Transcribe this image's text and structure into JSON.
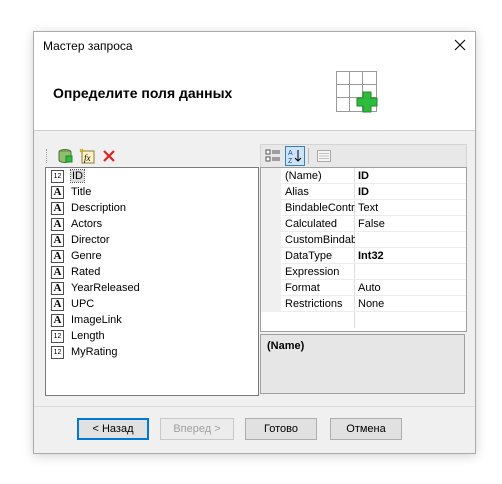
{
  "window": {
    "title": "Мастер запроса"
  },
  "header": {
    "heading": "Определите поля данных",
    "icon": "table-add-icon"
  },
  "fields_toolbar": {
    "items": [
      "add-data-field-icon",
      "add-calculated-field-icon",
      "delete-icon"
    ]
  },
  "fields": [
    {
      "name": "ID",
      "type": "12",
      "kind": "numeric",
      "selected": true
    },
    {
      "name": "Title",
      "type": "A",
      "kind": "string"
    },
    {
      "name": "Description",
      "type": "A",
      "kind": "string"
    },
    {
      "name": "Actors",
      "type": "A",
      "kind": "string"
    },
    {
      "name": "Director",
      "type": "A",
      "kind": "string"
    },
    {
      "name": "Genre",
      "type": "A",
      "kind": "string"
    },
    {
      "name": "Rated",
      "type": "A",
      "kind": "string"
    },
    {
      "name": "YearReleased",
      "type": "A",
      "kind": "string"
    },
    {
      "name": "UPC",
      "type": "A",
      "kind": "string"
    },
    {
      "name": "ImageLink",
      "type": "A",
      "kind": "string"
    },
    {
      "name": "Length",
      "type": "12",
      "kind": "numeric"
    },
    {
      "name": "MyRating",
      "type": "12",
      "kind": "numeric"
    }
  ],
  "properties": [
    {
      "name": "(Name)",
      "value": "ID",
      "bold": true
    },
    {
      "name": "Alias",
      "value": "ID",
      "bold": true
    },
    {
      "name": "BindableControl",
      "value": "Text"
    },
    {
      "name": "Calculated",
      "value": "False"
    },
    {
      "name": "CustomBindable",
      "value": ""
    },
    {
      "name": "DataType",
      "value": "Int32",
      "bold": true
    },
    {
      "name": "Expression",
      "value": ""
    },
    {
      "name": "Format",
      "value": "Auto"
    },
    {
      "name": "Restrictions",
      "value": "None"
    }
  ],
  "description": {
    "title": "(Name)"
  },
  "buttons": {
    "back": "< Назад",
    "next": "Вперед >",
    "finish": "Готово",
    "cancel": "Отмена"
  },
  "colors": {
    "accent": "#0078d7",
    "add_icon": "#2dbb3c",
    "delete_icon": "#e02424"
  }
}
